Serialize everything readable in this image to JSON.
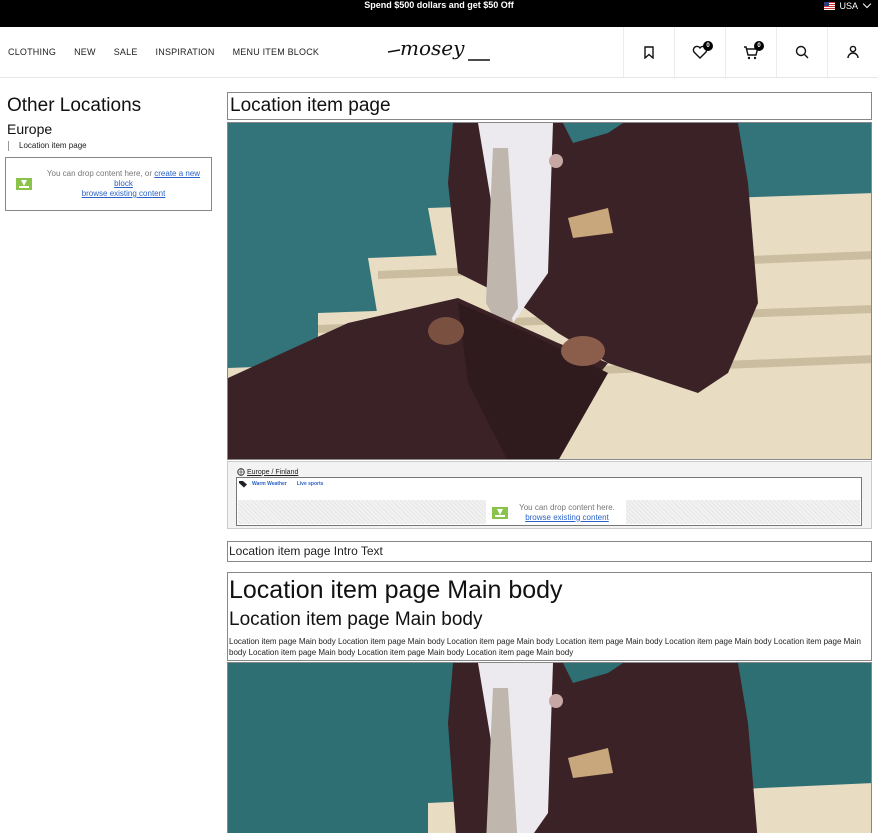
{
  "promo": {
    "text": "Spend $500 dollars and get $50 Off",
    "region": "USA"
  },
  "nav": {
    "items": [
      "CLOTHING",
      "NEW",
      "SALE",
      "INSPIRATION",
      "MENU ITEM BLOCK"
    ]
  },
  "logo": {
    "text": "mosey"
  },
  "header_icons": {
    "wishlist_count": "0",
    "cart_count": "0"
  },
  "sidebar": {
    "title": "Other Locations",
    "region": "Europe",
    "link": "Location item page",
    "dropzone": {
      "text": "You can drop content here, or ",
      "create_link": "create a new block",
      "browse_link": "browse existing content"
    }
  },
  "main": {
    "title": "Location item page",
    "crumb": "Europe / Finland",
    "tags": [
      "Warm Weather",
      "Live sports"
    ],
    "tag_dropzone": {
      "text": "You can drop content here.",
      "browse_link": "browse existing content"
    },
    "intro": "Location item page Intro Text",
    "body_h1": "Location item page Main body",
    "body_h2": "Location item page Main body",
    "body_text": "Location item page Main body Location item page Main body Location item page Main body Location item page Main body Location item page Main body Location item page Main body Location item page Main body Location item page Main body Location item page Main body"
  },
  "colors": {
    "promo_bg": "#000000",
    "link": "#2a62c9",
    "drop_icon": "#8bc34a",
    "wall": "#2e6f74"
  }
}
